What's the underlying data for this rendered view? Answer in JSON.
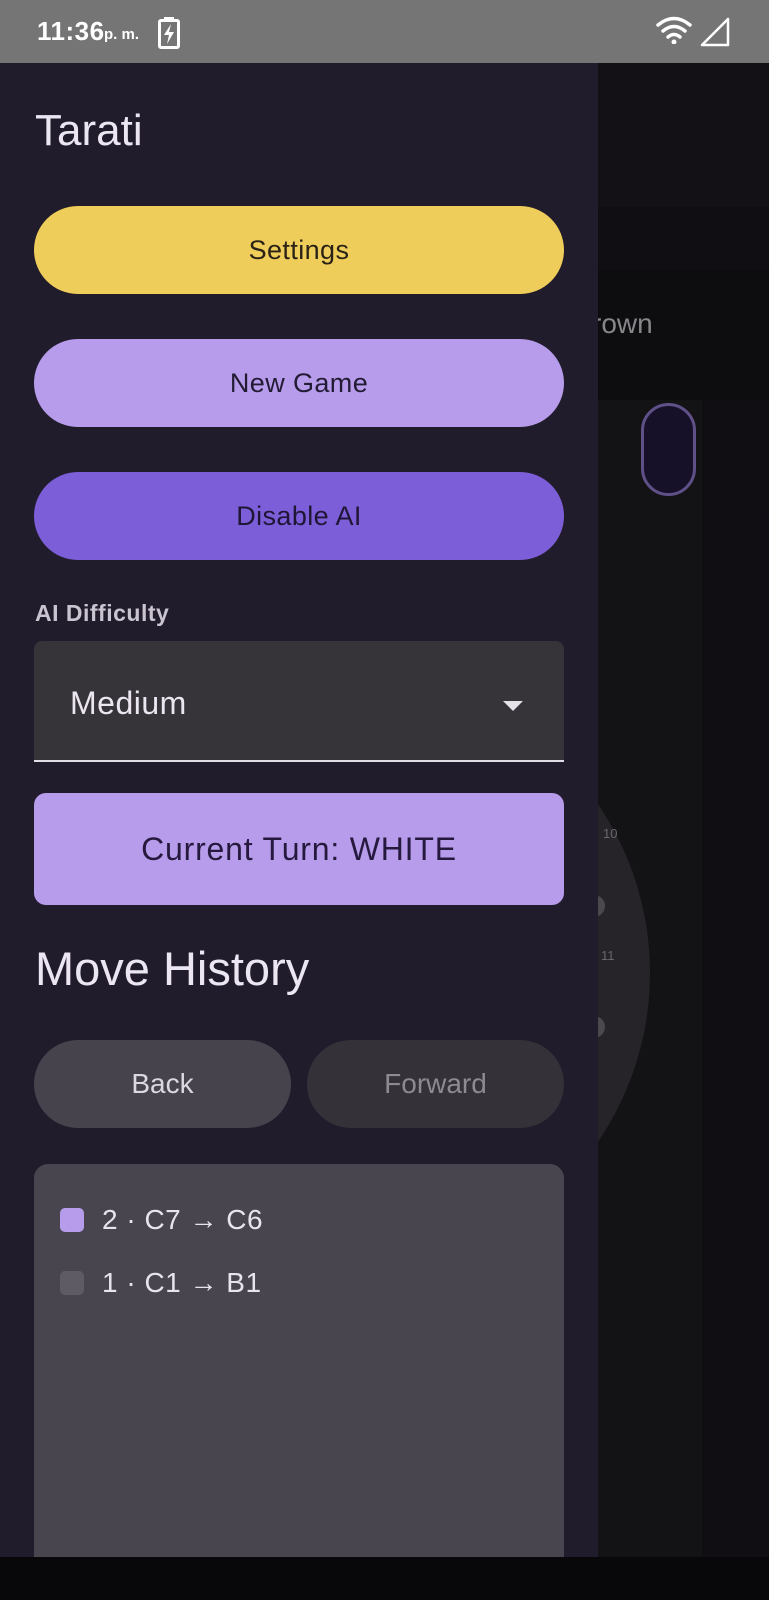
{
  "status_bar": {
    "time": "11:36",
    "ampm": "p. m.",
    "icons": [
      "battery-charging-icon",
      "wifi-icon",
      "cell-signal-icon"
    ]
  },
  "background_app": {
    "player_label": "rown",
    "board_labels": [
      "10",
      "11"
    ]
  },
  "drawer": {
    "title": "Tarati",
    "buttons": {
      "settings": "Settings",
      "new_game": "New Game",
      "disable_ai": "Disable AI"
    },
    "ai_difficulty": {
      "label": "AI Difficulty",
      "selected": "Medium",
      "icon": "dropdown-arrow-icon"
    },
    "current_turn": "Current Turn: WHITE",
    "move_history": {
      "title": "Move History",
      "back_label": "Back",
      "forward_label": "Forward",
      "moves": [
        {
          "text": "2 · C7 → C6",
          "selected": true
        },
        {
          "text": "1 · C1 → B1",
          "selected": false
        }
      ]
    }
  },
  "colors": {
    "drawer_bg": "#211c2b",
    "settings_yellow": "#efcd5a",
    "primary_light": "#b79ceb",
    "primary": "#7c5ed8",
    "surface_variant": "#48454f"
  }
}
